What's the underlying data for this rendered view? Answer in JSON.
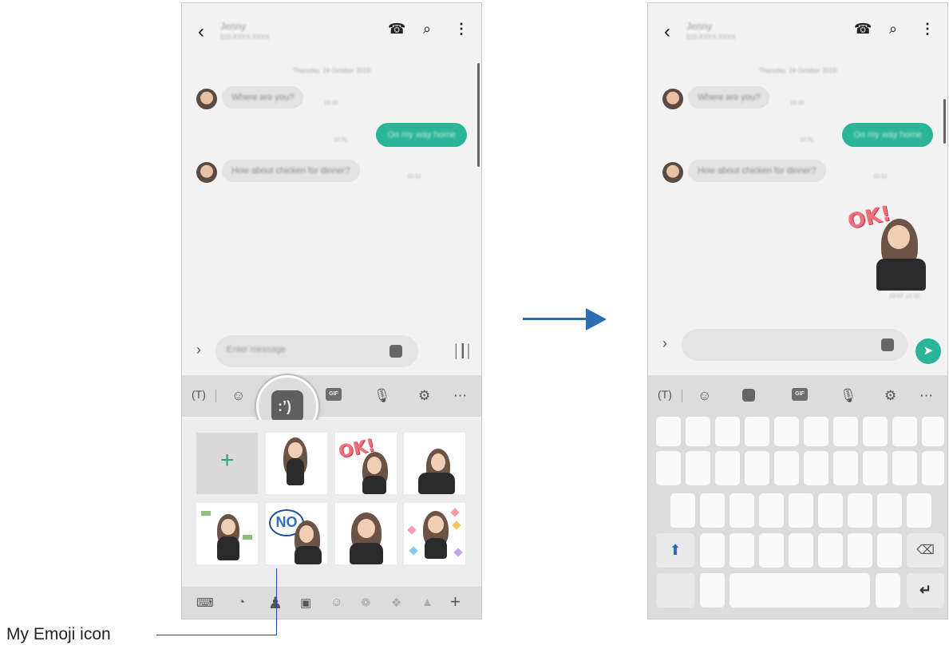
{
  "conversation": {
    "contact_name": "Jenny",
    "contact_number": "010-XXXX-XXXX",
    "date": "Thursday, 24 October 2019",
    "messages": [
      {
        "dir": "in",
        "text": "Where are you?",
        "time": "10:30"
      },
      {
        "dir": "out",
        "text": "On my way home",
        "time": "10:31"
      },
      {
        "dir": "in",
        "text": "How about chicken for dinner?",
        "time": "10:32"
      }
    ],
    "sent_sticker_time": "SENT 10:33"
  },
  "input": {
    "placeholder": "Enter message"
  },
  "toolbar": {
    "gif_label": "GIF"
  },
  "stickers": {
    "add_label": "+",
    "ok_text": "OK!",
    "no_text": "NO"
  },
  "callout": {
    "label": "My Emoji icon"
  },
  "colors": {
    "accent": "#2bb598",
    "arrow": "#2e6db4",
    "callout_line": "#1d4f9a",
    "background": "#f2f2f2"
  },
  "icons": {
    "back": "chevron-left-icon",
    "call": "phone-icon",
    "search": "search-icon",
    "more": "more-vert-icon",
    "sticker": "sticker-icon",
    "voice": "waveform-icon",
    "send": "send-icon"
  }
}
